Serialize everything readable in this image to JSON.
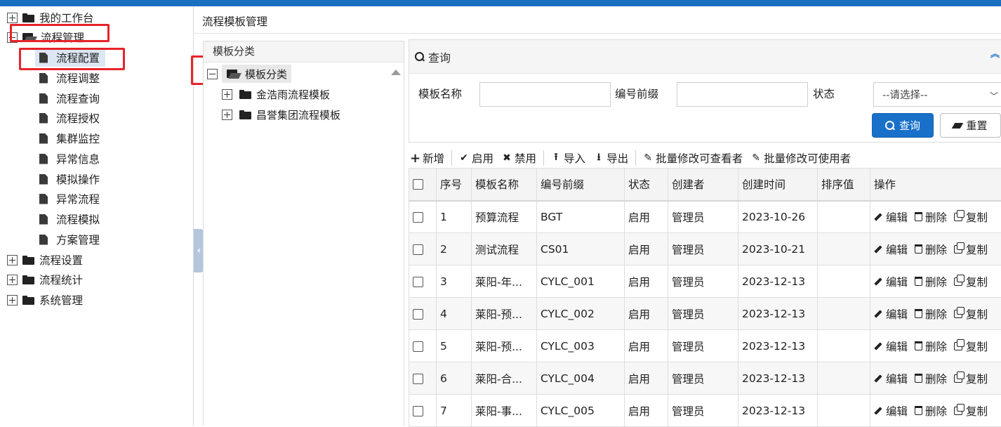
{
  "colors": {
    "accent": "#1a6fc0",
    "primary_button": "#1870c9",
    "highlight_box": "#e8232a",
    "selected_row": "#dde7f3"
  },
  "sidebar": {
    "groups": [
      {
        "label": "我的工作台",
        "expanded": false
      },
      {
        "label": "流程管理",
        "expanded": true,
        "children": [
          "流程配置",
          "流程调整",
          "流程查询",
          "流程授权",
          "集群监控",
          "异常信息",
          "模拟操作",
          "异常流程",
          "流程模拟",
          "方案管理"
        ],
        "selected_child": "流程配置"
      },
      {
        "label": "流程设置",
        "expanded": false
      },
      {
        "label": "流程统计",
        "expanded": false
      },
      {
        "label": "系统管理",
        "expanded": false
      }
    ]
  },
  "page": {
    "title": "流程模板管理"
  },
  "category_panel": {
    "header": "模板分类",
    "root": "模板分类",
    "nodes": [
      "金浩雨流程模板",
      "昌誉集团流程模板"
    ]
  },
  "query": {
    "header": "查询",
    "template_name_label": "模板名称",
    "template_name_value": "",
    "prefix_label": "编号前缀",
    "prefix_value": "",
    "status_label": "状态",
    "status_selected": "--请选择--",
    "search_button": "查询",
    "reset_button": "重置"
  },
  "toolbar": {
    "add": "新增",
    "enable": "启用",
    "disable": "禁用",
    "import": "导入",
    "export": "导出",
    "batch_viewers": "批量修改可查看者",
    "batch_users": "批量修改可使用者"
  },
  "table": {
    "columns": [
      "序号",
      "模板名称",
      "编号前缀",
      "状态",
      "创建者",
      "创建时间",
      "排序值",
      "操作"
    ],
    "actions": [
      "编辑",
      "删除",
      "复制"
    ],
    "rows": [
      {
        "index": "1",
        "name": "预算流程",
        "prefix": "BGT",
        "status": "启用",
        "creator": "管理员",
        "created": "2023-10-26",
        "sort": ""
      },
      {
        "index": "2",
        "name": "测试流程",
        "prefix": "CS01",
        "status": "启用",
        "creator": "管理员",
        "created": "2023-10-21",
        "sort": ""
      },
      {
        "index": "3",
        "name": "莱阳-年...",
        "prefix": "CYLC_001",
        "status": "启用",
        "creator": "管理员",
        "created": "2023-12-13",
        "sort": ""
      },
      {
        "index": "4",
        "name": "莱阳-预...",
        "prefix": "CYLC_002",
        "status": "启用",
        "creator": "管理员",
        "created": "2023-12-13",
        "sort": ""
      },
      {
        "index": "5",
        "name": "莱阳-预...",
        "prefix": "CYLC_003",
        "status": "启用",
        "creator": "管理员",
        "created": "2023-12-13",
        "sort": ""
      },
      {
        "index": "6",
        "name": "莱阳-合...",
        "prefix": "CYLC_004",
        "status": "启用",
        "creator": "管理员",
        "created": "2023-12-13",
        "sort": ""
      },
      {
        "index": "7",
        "name": "莱阳-事...",
        "prefix": "CYLC_005",
        "status": "启用",
        "creator": "管理员",
        "created": "2023-12-13",
        "sort": ""
      }
    ]
  }
}
